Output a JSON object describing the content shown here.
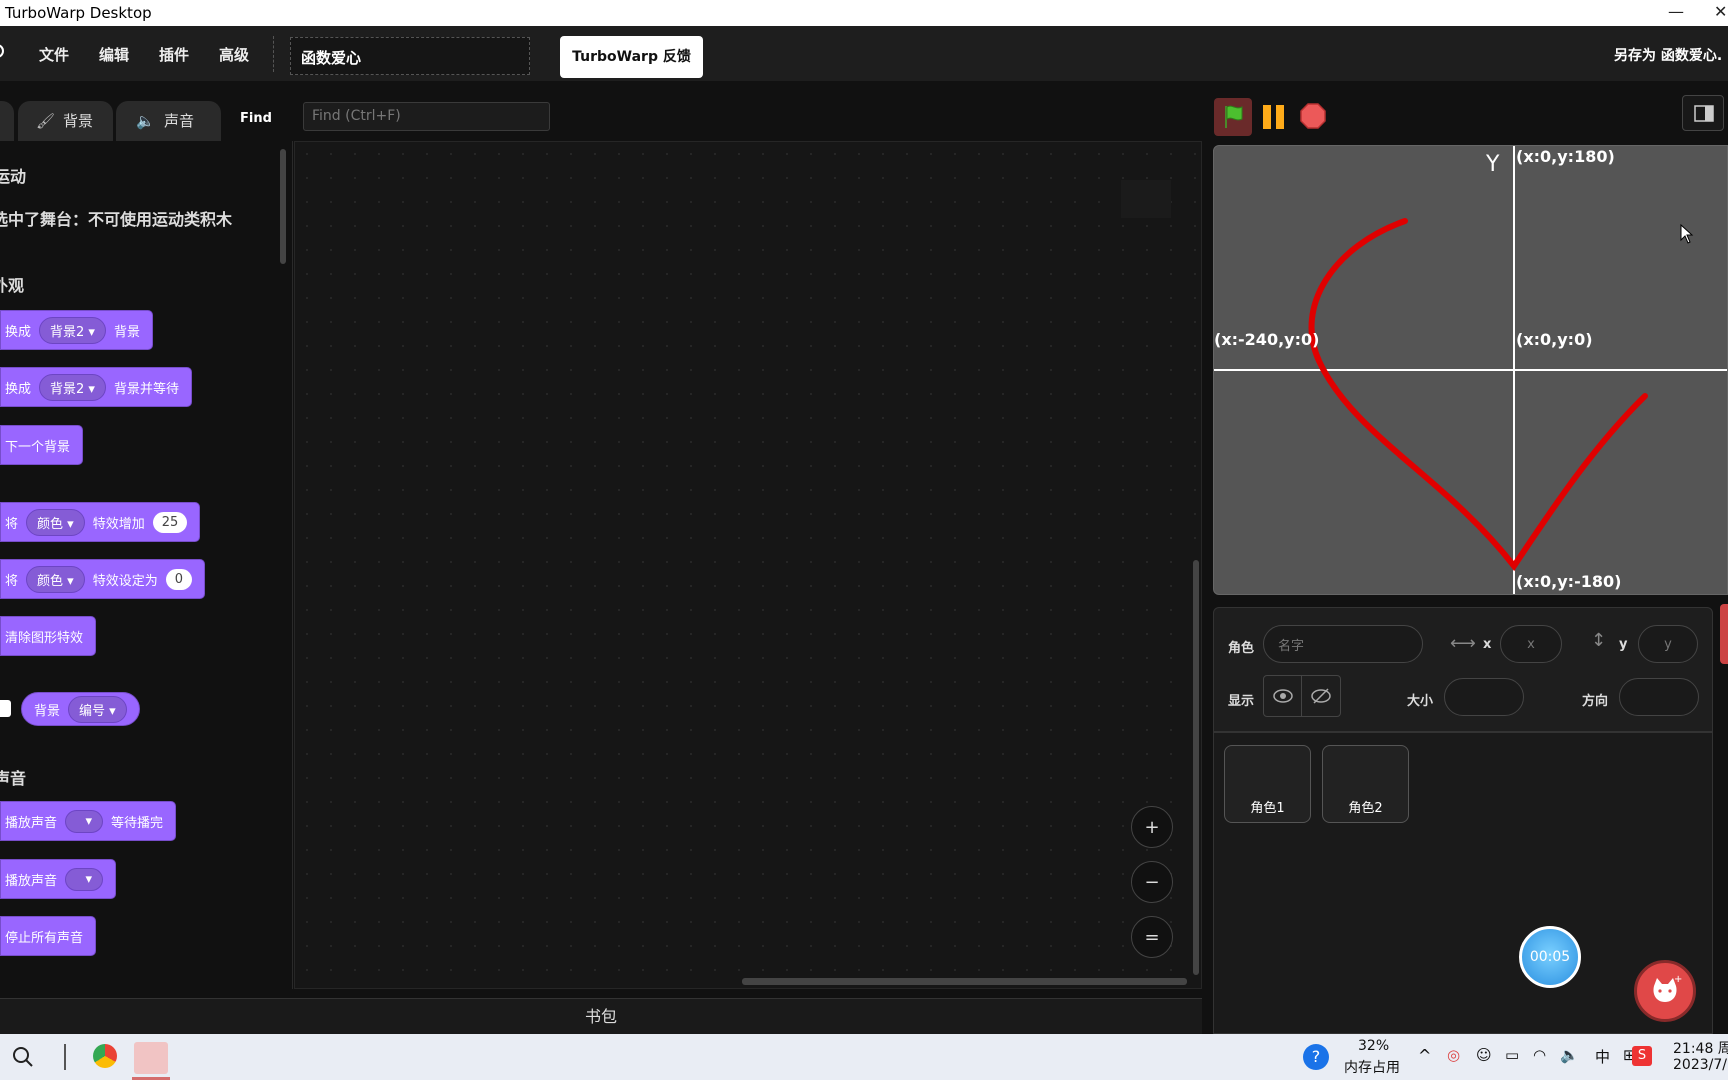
{
  "window": {
    "title": "TurboWarp Desktop",
    "minimize": "—",
    "close": "✕"
  },
  "menu": {
    "items": [
      "文件",
      "编辑",
      "插件",
      "高级"
    ],
    "project_title": "函数爱心",
    "feedback_button": "TurboWarp 反馈",
    "save_as": "另存为 函数爱心."
  },
  "tabs": {
    "backdrop": "背景",
    "sound": "声音",
    "find_label": "Find",
    "find_placeholder": "Find (Ctrl+F)"
  },
  "palette": {
    "motion_heading": "运动",
    "motion_note": "选中了舞台：不可使用运动类积木",
    "looks_heading": "外观",
    "blocks": {
      "switch_backdrop": {
        "pre": "换成",
        "menu": "背景2",
        "post": "背景"
      },
      "switch_backdrop_wait": {
        "pre": "换成",
        "menu": "背景2",
        "post": "背景并等待"
      },
      "next_backdrop": "下一个背景",
      "change_effect": {
        "pre": "将",
        "menu": "颜色",
        "mid": "特效增加",
        "value": "25"
      },
      "set_effect": {
        "pre": "将",
        "menu": "颜色",
        "mid": "特效设定为",
        "value": "0"
      },
      "clear_effects": "清除图形特效",
      "backdrop_reporter": {
        "label": "背景",
        "menu": "编号"
      }
    },
    "sound_heading": "声音",
    "sound_blocks": {
      "play_until_done": {
        "pre": "播放声音",
        "post": "等待播完"
      },
      "start_sound": "播放声音",
      "stop_all": "停止所有声音"
    }
  },
  "workspace": {
    "zoom_in": "+",
    "zoom_out": "−",
    "zoom_reset": "="
  },
  "backpack": {
    "label": "书包"
  },
  "stage": {
    "labels": {
      "y_axis": "Y",
      "top": "(x:0,y:180)",
      "left": "(x:-240,y:0)",
      "center": "(x:0,y:0)",
      "bottom": "(x:0,y:-180)"
    },
    "colors": {
      "background": "#555555",
      "curve": "#e00000",
      "axis": "#ffffff"
    }
  },
  "sprite_info": {
    "sprite_label": "角色",
    "name_placeholder": "名字",
    "x_label": "x",
    "x_placeholder": "x",
    "y_label": "y",
    "y_placeholder": "y",
    "show_label": "显示",
    "size_label": "大小",
    "direction_label": "方向"
  },
  "sprites": [
    "角色1",
    "角色2"
  ],
  "timer": "00:05",
  "taskbar": {
    "memory_percent": "32%",
    "memory_label": "内存占用",
    "ime": "中",
    "time": "21:48 周",
    "date": "2023/7/"
  }
}
